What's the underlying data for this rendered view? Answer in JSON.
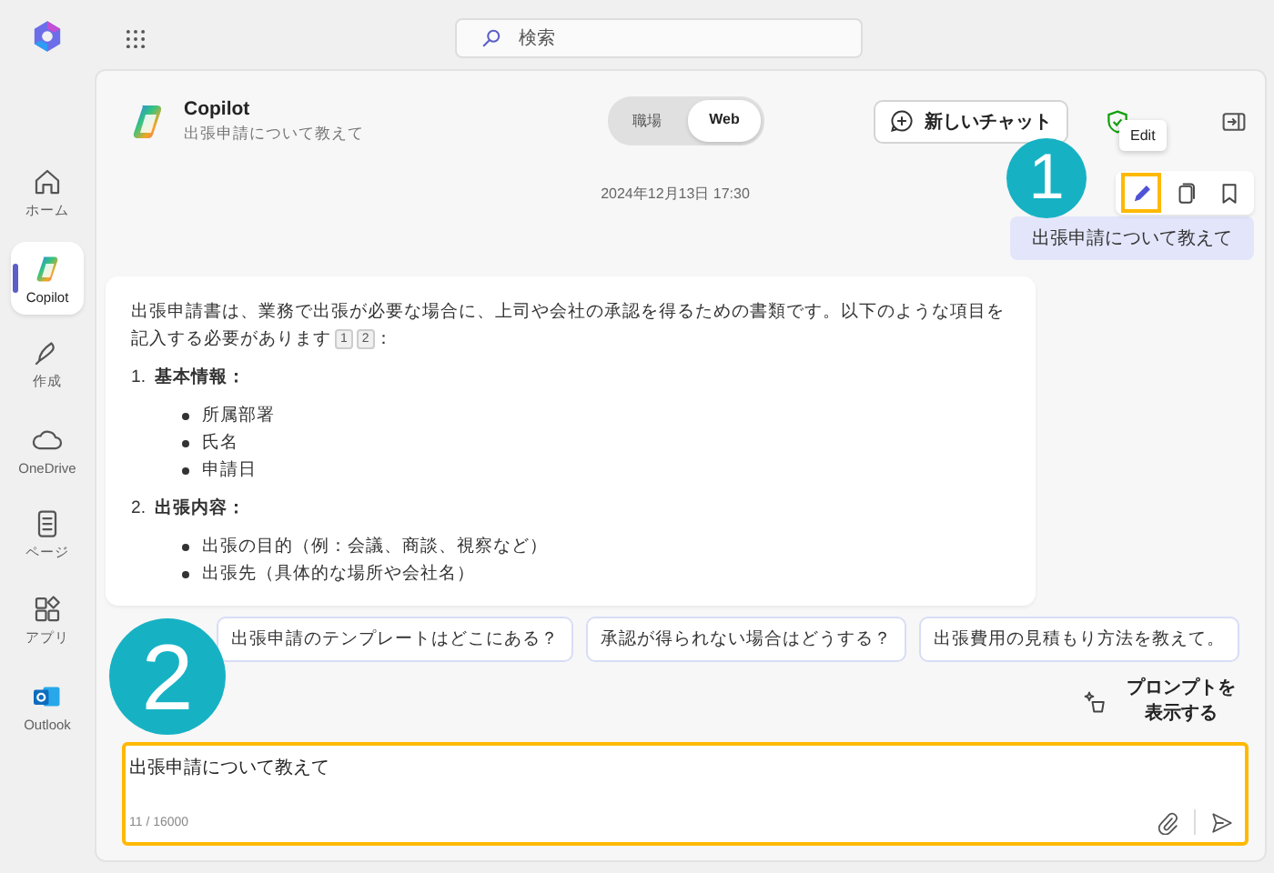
{
  "sidebar": {
    "items": [
      {
        "kind": "home",
        "label": "ホーム",
        "selected": false
      },
      {
        "kind": "copilot",
        "label": "Copilot",
        "selected": true
      },
      {
        "kind": "create",
        "label": "作成",
        "selected": false
      },
      {
        "kind": "onedrive",
        "label": "OneDrive",
        "selected": false
      },
      {
        "kind": "pages",
        "label": "ページ",
        "selected": false
      },
      {
        "kind": "apps",
        "label": "アプリ",
        "selected": false
      },
      {
        "kind": "outlook",
        "label": "Outlook",
        "selected": false
      }
    ]
  },
  "search": {
    "placeholder": "検索"
  },
  "chat_header": {
    "title": "Copilot",
    "subtitle": "出張申請について教えて",
    "mode_tabs": [
      {
        "label": "職場",
        "selected": false
      },
      {
        "label": "Web",
        "selected": true
      }
    ],
    "new_chat_button": "新しいチャット"
  },
  "timestamp": "2024年12月13日 17:30",
  "message_toolbar": {
    "tooltip": "Edit",
    "edit_highlighted": true
  },
  "user_message": "出張申請について教えて",
  "answer": {
    "intro": "出張申請書は、業務で出張が必要な場合に、上司や会社の承認を得るための書類です。以下のような項目を記入する必要があります",
    "citations": [
      "1",
      "2"
    ],
    "intro_end": "：",
    "sections": [
      {
        "number": "1.",
        "heading": "基本情報：",
        "items": [
          "所属部署",
          "氏名",
          "申請日"
        ]
      },
      {
        "number": "2.",
        "heading": "出張内容：",
        "items": [
          "出張の目的（例：会議、商談、視察など）",
          "出張先（具体的な場所や会社名）"
        ]
      }
    ]
  },
  "suggestions": [
    "出張申請のテンプレートはどこにある？",
    "承認が得られない場合はどうする？",
    "出張費用の見積もり方法を教えて。"
  ],
  "prompt_button": "プロンプトを表示する",
  "input": {
    "value": "出張申請について教えて",
    "counter": "11 / 16000",
    "highlighted": true
  },
  "annotations": [
    {
      "label": "1"
    },
    {
      "label": "2"
    }
  ]
}
